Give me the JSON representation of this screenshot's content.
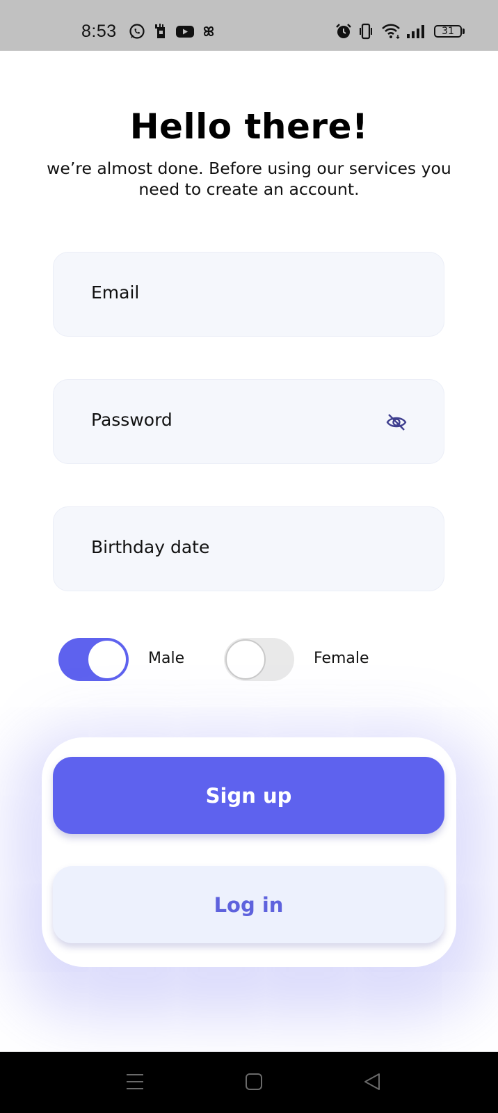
{
  "status_bar": {
    "time": "8:53",
    "battery": "31",
    "left_icons": [
      "whatsapp-icon",
      "sim-icon",
      "youtube-icon",
      "pinwheel-icon"
    ],
    "right_icons": [
      "alarm-icon",
      "vibrate-icon",
      "wifi-icon",
      "signal-icon",
      "battery-icon"
    ]
  },
  "header": {
    "title": "Hello there!",
    "subtitle": "we’re almost done. Before using our services you need to create an account."
  },
  "form": {
    "email_placeholder": "Email",
    "password_placeholder": "Password",
    "birthday_placeholder": "Birthday date",
    "password_visibility_icon": "eye-off-icon"
  },
  "gender": {
    "male_label": "Male",
    "male_on": true,
    "female_label": "Female",
    "female_on": false
  },
  "actions": {
    "signup_label": "Sign up",
    "login_label": "Log in"
  },
  "nav_bar": {
    "icons": [
      "menu-icon",
      "home-icon",
      "back-icon"
    ]
  },
  "colors": {
    "accent": "#5e62ee",
    "field_bg": "#f5f7fc",
    "secondary_button_bg": "#edf1fd",
    "status_bar_bg": "#c1c1c1",
    "nav_bar_bg": "#000000"
  }
}
